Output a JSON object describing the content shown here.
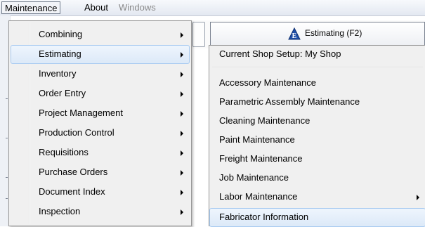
{
  "menubar": {
    "items": [
      {
        "label": "Maintenance",
        "state": "open"
      },
      {
        "label": "About",
        "state": "normal"
      },
      {
        "label": "Windows",
        "state": "disabled"
      }
    ]
  },
  "maintenance_menu": {
    "items": [
      {
        "label": "Combining",
        "has_submenu": true
      },
      {
        "label": "Estimating",
        "has_submenu": true,
        "highlighted": true
      },
      {
        "label": "Inventory",
        "has_submenu": true
      },
      {
        "label": "Order Entry",
        "has_submenu": true
      },
      {
        "label": "Project Management",
        "has_submenu": true
      },
      {
        "label": "Production Control",
        "has_submenu": true
      },
      {
        "label": "Requisitions",
        "has_submenu": true
      },
      {
        "label": "Purchase Orders",
        "has_submenu": true
      },
      {
        "label": "Document Index",
        "has_submenu": true
      },
      {
        "label": "Inspection",
        "has_submenu": true
      }
    ]
  },
  "background_window": {
    "tab_label": "Estimating (F2)",
    "tab_icon": "estimating-icon",
    "icon_letter": "E"
  },
  "estimating_submenu": {
    "header_item": "Current Shop Setup: My Shop",
    "items": [
      {
        "label": "Accessory Maintenance",
        "has_submenu": false
      },
      {
        "label": "Parametric Assembly Maintenance",
        "has_submenu": false
      },
      {
        "label": "Cleaning Maintenance",
        "has_submenu": false
      },
      {
        "label": "Paint Maintenance",
        "has_submenu": false
      },
      {
        "label": "Freight Maintenance",
        "has_submenu": false
      },
      {
        "label": "Job Maintenance",
        "has_submenu": false
      },
      {
        "label": "Labor Maintenance",
        "has_submenu": true
      },
      {
        "label": "Fabricator Information",
        "has_submenu": false,
        "highlighted": true
      }
    ]
  },
  "colors": {
    "highlight_fill": "#dce9f8",
    "highlight_border": "#a8cbf1",
    "menu_background": "#f0f0f0",
    "tab_icon_blue": "#1f4fa8"
  }
}
